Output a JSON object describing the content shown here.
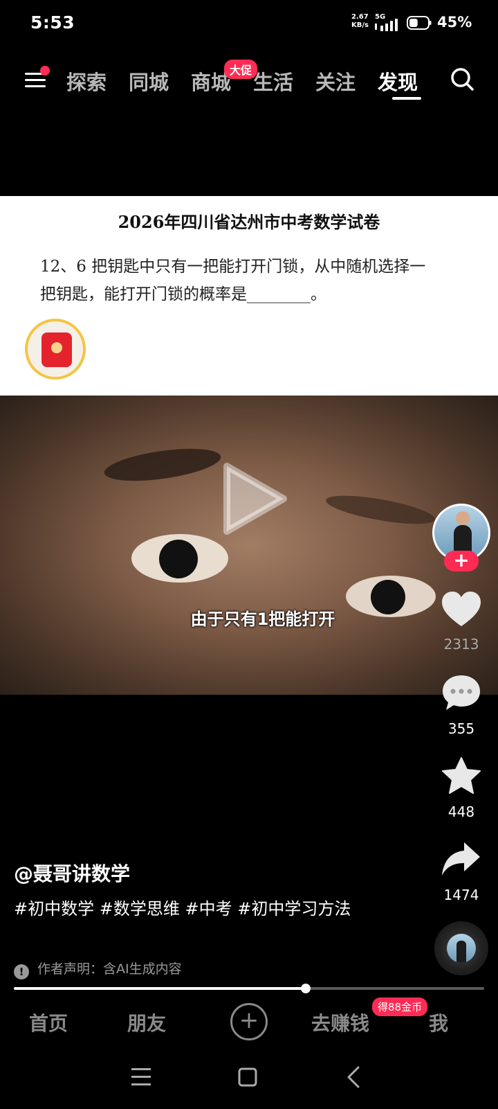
{
  "status_bar": {
    "time": "5:53",
    "net_speed_value": "2.67",
    "net_speed_unit": "KB/s",
    "network": "5G",
    "battery": "45%",
    "battery_level": 0.45
  },
  "top_nav": {
    "tabs": [
      "探索",
      "同城",
      "商城",
      "生活",
      "关注",
      "发现"
    ],
    "active_tab": "发现",
    "promo_badge": "大促"
  },
  "question_card": {
    "title": "2026年四川省达州市中考数学试卷",
    "line1": "12、6 把钥匙中只有一把能打开门锁，从中随机选择一",
    "line2": "把钥匙，能打开门锁的概率是________。"
  },
  "video": {
    "subtitle": "由于只有1把能打开"
  },
  "right_rail": {
    "likes": "2313",
    "comments": "355",
    "favorites": "448",
    "shares": "1474",
    "follow_symbol": "+"
  },
  "caption": {
    "author": "@聂哥讲数学",
    "hashtags": "#初中数学 #数学思维 #中考 #初中学习方法",
    "ai_note": "作者声明：含AI生成内容",
    "ai_note_icon": "!"
  },
  "progress": {
    "fraction": 0.62
  },
  "bottom_tabs": {
    "home": "首页",
    "friends": "朋友",
    "add": "+",
    "earn": "去赚钱",
    "me": "我",
    "coin_badge": "得88金币"
  },
  "colors": {
    "accent": "#fe2c55",
    "background": "#000000"
  }
}
